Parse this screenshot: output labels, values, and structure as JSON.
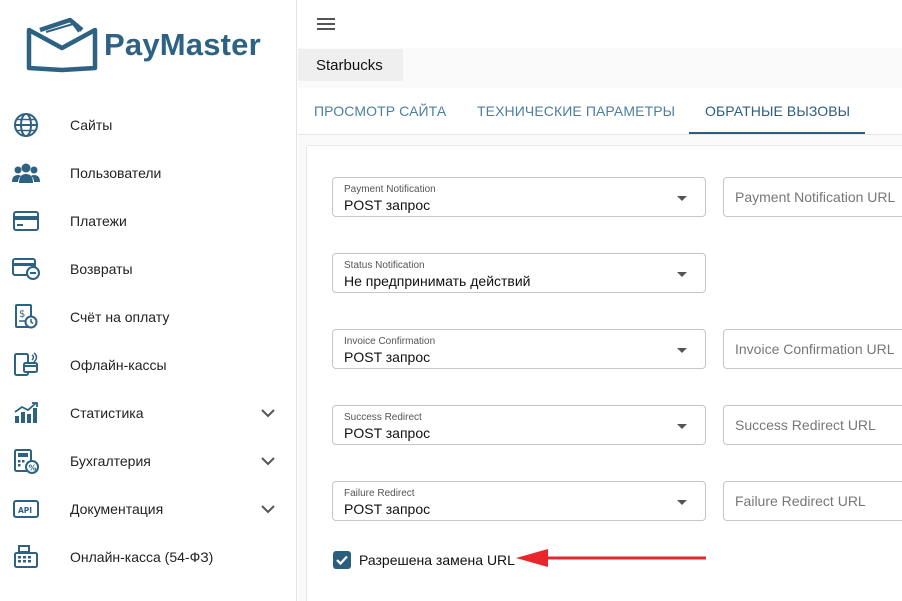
{
  "brand": {
    "name": "PayMaster"
  },
  "sidebar": {
    "items": [
      {
        "label": "Сайты",
        "icon": "globe-icon"
      },
      {
        "label": "Пользователи",
        "icon": "users-icon"
      },
      {
        "label": "Платежи",
        "icon": "credit-card-icon"
      },
      {
        "label": "Возвраты",
        "icon": "refund-card-icon"
      },
      {
        "label": "Счёт на оплату",
        "icon": "invoice-icon"
      },
      {
        "label": "Офлайн-кассы",
        "icon": "pos-terminal-icon"
      },
      {
        "label": "Статистика",
        "icon": "bar-chart-icon",
        "expandable": true
      },
      {
        "label": "Бухгалтерия",
        "icon": "accounting-icon",
        "expandable": true
      },
      {
        "label": "Документация",
        "icon": "api-doc-icon",
        "expandable": true
      },
      {
        "label": "Онлайн-касса (54-ФЗ)",
        "icon": "cash-register-icon"
      }
    ]
  },
  "header": {
    "site_name": "Starbucks"
  },
  "tabs": [
    {
      "label": "ПРОСМОТР САЙТА"
    },
    {
      "label": "ТЕХНИЧЕСКИЕ ПАРАМЕТРЫ"
    },
    {
      "label": "ОБРАТНЫЕ ВЫЗОВЫ",
      "active": true
    }
  ],
  "callbacks": {
    "rows": [
      {
        "label": "Payment Notification",
        "value": "POST запрос",
        "url_placeholder": "Payment Notification URL"
      },
      {
        "label": "Status Notification",
        "value": "Не предпринимать действий"
      },
      {
        "label": "Invoice Confirmation",
        "value": "POST запрос",
        "url_placeholder": "Invoice Confirmation URL"
      },
      {
        "label": "Success Redirect",
        "value": "POST запрос",
        "url_placeholder": "Success Redirect URL"
      },
      {
        "label": "Failure Redirect",
        "value": "POST запрос",
        "url_placeholder": "Failure Redirect URL"
      }
    ],
    "allow_url_override": {
      "label": "Разрешена замена URL",
      "checked": true
    }
  },
  "colors": {
    "primary": "#2b5f80",
    "brand": "#2e6283",
    "annotation_arrow": "#e8262b"
  }
}
